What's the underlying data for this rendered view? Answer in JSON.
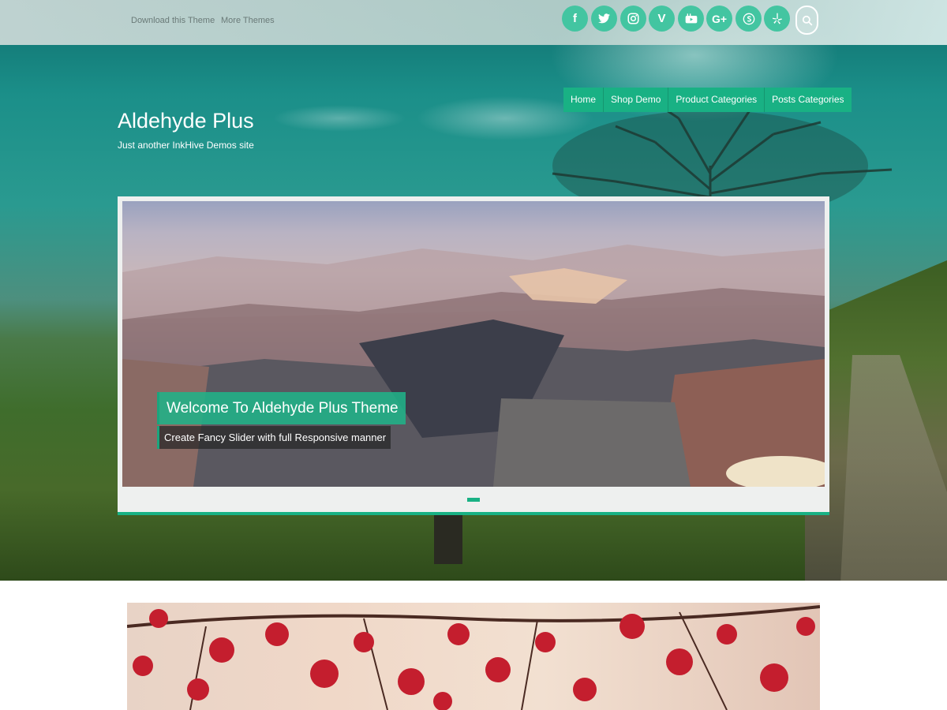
{
  "topbar": {
    "links": [
      "Download this Theme",
      "More Themes"
    ],
    "social": [
      {
        "icon": "facebook-icon",
        "glyph": "f"
      },
      {
        "icon": "twitter-icon",
        "glyph": ""
      },
      {
        "icon": "instagram-icon",
        "glyph": ""
      },
      {
        "icon": "vine-icon",
        "glyph": "V"
      },
      {
        "icon": "youtube-icon",
        "glyph": ""
      },
      {
        "icon": "google-plus-icon",
        "glyph": "G+"
      },
      {
        "icon": "skype-icon",
        "glyph": ""
      },
      {
        "icon": "yelp-icon",
        "glyph": ""
      }
    ],
    "search_icon": "search-icon"
  },
  "site": {
    "title": "Aldehyde Plus",
    "description": "Just another InkHive Demos site"
  },
  "nav": {
    "items": [
      "Home",
      "Shop Demo",
      "Product Categories",
      "Posts Categories"
    ]
  },
  "slider": {
    "caption_title": "Welcome To Aldehyde Plus Theme",
    "caption_text": "Create Fancy Slider with full Responsive manner"
  },
  "colors": {
    "accent": "#19b184",
    "social_bg": "#43c5a1"
  }
}
